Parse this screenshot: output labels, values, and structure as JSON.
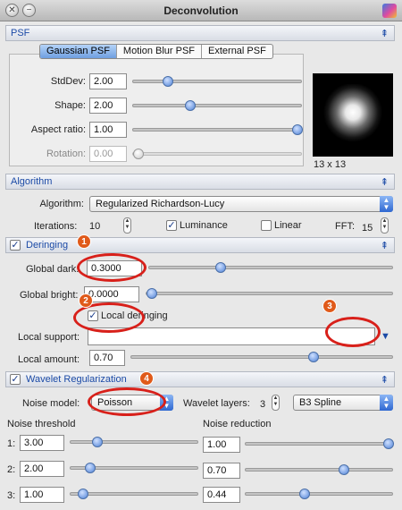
{
  "window": {
    "title": "Deconvolution"
  },
  "psf": {
    "section": "PSF",
    "tabs": [
      "Gaussian PSF",
      "Motion Blur PSF",
      "External PSF"
    ],
    "fields": [
      {
        "label": "StdDev:",
        "value": "2.00",
        "level": 0.2
      },
      {
        "label": "Shape:",
        "value": "2.00",
        "level": 0.34
      },
      {
        "label": "Aspect ratio:",
        "value": "1.00",
        "level": 1.0
      },
      {
        "label": "Rotation:",
        "value": "0.00",
        "level": 0.0
      }
    ],
    "preview_size": "13 x 13"
  },
  "algorithm": {
    "section": "Algorithm",
    "label": "Algorithm:",
    "value": "Regularized Richardson-Lucy",
    "iterations_label": "Iterations:",
    "iterations": "10",
    "luminance": "Luminance",
    "linear": "Linear",
    "fft_label": "FFT:",
    "fft": "15"
  },
  "deringing": {
    "section": "Deringing",
    "global_dark_label": "Global dark:",
    "global_dark": "0.3000",
    "global_dark_level": 0.3,
    "global_bright_label": "Global bright:",
    "global_bright": "0.0000",
    "global_bright_level": 0.0,
    "local_label": "Local deringing",
    "local_support_label": "Local support:",
    "local_support": "",
    "local_amount_label": "Local amount:",
    "local_amount": "0.70",
    "local_amount_level": 0.7
  },
  "wavelet": {
    "section": "Wavelet Regularization",
    "noise_model_label": "Noise model:",
    "noise_model": "Poisson",
    "layers_label": "Wavelet layers:",
    "layers": "3",
    "scaling": "B3 Spline",
    "threshold_header": "Noise threshold",
    "reduction_header": "Noise reduction",
    "rows": [
      {
        "label": "1:",
        "threshold": "3.00",
        "reduction": "1.00"
      },
      {
        "label": "2:",
        "threshold": "2.00",
        "reduction": "0.70"
      },
      {
        "label": "3:",
        "threshold": "1.00",
        "reduction": "0.44"
      }
    ]
  },
  "markers": [
    "1",
    "2",
    "3",
    "4"
  ],
  "colors": {
    "accent": "#1b4aa6",
    "annotation": "#d8201a"
  }
}
